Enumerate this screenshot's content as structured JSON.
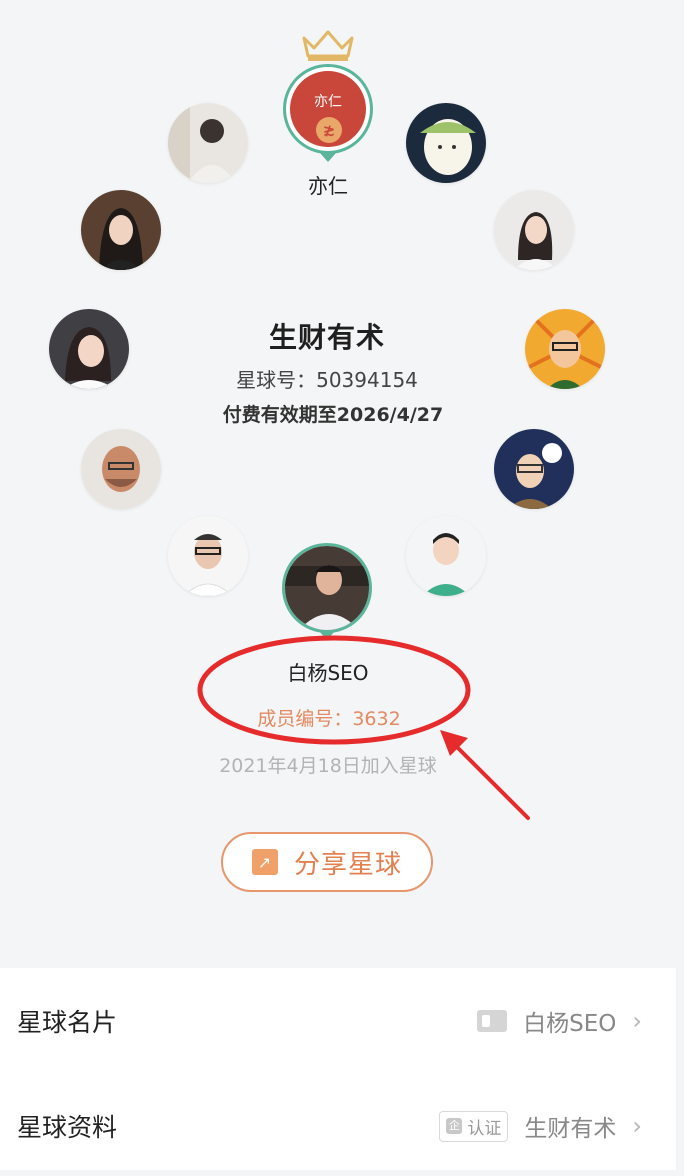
{
  "owner": {
    "name": "亦仁",
    "badge_text": "亦仁",
    "coin_glyph": "≵"
  },
  "planet": {
    "name": "生财有术",
    "id_line": "星球号：50394154",
    "expiry_line": "付费有效期至2026/4/27"
  },
  "member": {
    "name": "白杨SEO",
    "number_line": "成员编号：3632",
    "join_line": "2021年4月18日加入星球"
  },
  "share_button": {
    "label": "分享星球"
  },
  "list": {
    "card": {
      "label": "星球名片",
      "value": "白杨SEO"
    },
    "profile": {
      "label": "星球资料",
      "badge": "认证",
      "badge_icon": "企",
      "value": "生财有术"
    }
  },
  "colors": {
    "accent_orange": "#e2804f",
    "ring_green": "#5bb59a",
    "owner_red": "#c9463b",
    "annotation_red": "#e52b2b"
  }
}
